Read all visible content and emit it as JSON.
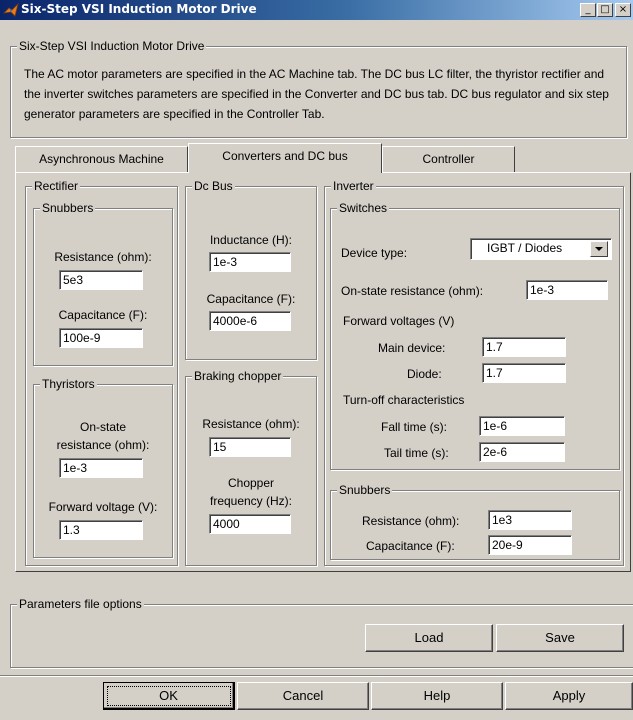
{
  "window": {
    "title": "Six-Step VSI Induction Motor Drive",
    "controls": [
      "_",
      "□",
      "×"
    ]
  },
  "header": {
    "group_title": "Six-Step VSI Induction Motor Drive",
    "description": "The AC motor parameters are specified in the AC Machine tab. The DC bus LC filter, the thyristor rectifier and the inverter switches parameters are specified in the Converter and DC bus tab. DC bus regulator and six step generator parameters are specified in the Controller Tab."
  },
  "tabs": [
    {
      "label": "Asynchronous Machine",
      "active": false
    },
    {
      "label": "Converters and DC bus",
      "active": true
    },
    {
      "label": "Controller",
      "active": false
    }
  ],
  "rectifier": {
    "title": "Rectifier",
    "snubbers": {
      "title": "Snubbers",
      "resistance_label": "Resistance (ohm):",
      "resistance_value": "5e3",
      "capacitance_label": "Capacitance (F):",
      "capacitance_value": "100e-9"
    },
    "thyristors": {
      "title": "Thyristors",
      "onstate_label_1": "On-state",
      "onstate_label_2": "resistance (ohm):",
      "onstate_value": "1e-3",
      "forward_voltage_label": "Forward voltage (V):",
      "forward_voltage_value": "1.3"
    }
  },
  "dc_bus": {
    "title": "Dc Bus",
    "inductance_label": "Inductance (H):",
    "inductance_value": "1e-3",
    "capacitance_label": "Capacitance (F):",
    "capacitance_value": "4000e-6"
  },
  "braking_chopper": {
    "title": "Braking chopper",
    "resistance_label": "Resistance (ohm):",
    "resistance_value": "15",
    "frequency_label_1": "Chopper",
    "frequency_label_2": "frequency (Hz):",
    "frequency_value": "4000"
  },
  "inverter": {
    "title": "Inverter",
    "switches": {
      "title": "Switches",
      "device_type_label": "Device type:",
      "device_type_value": "IGBT / Diodes",
      "onstate_label": "On-state resistance (ohm):",
      "onstate_value": "1e-3",
      "forward_voltages_label": "Forward voltages (V)",
      "main_device_label": "Main device:",
      "main_device_value": "1.7",
      "diode_label": "Diode:",
      "diode_value": "1.7",
      "turnoff_label": "Turn-off characteristics",
      "fall_time_label": "Fall time (s):",
      "fall_time_value": "1e-6",
      "tail_time_label": "Tail time (s):",
      "tail_time_value": "2e-6"
    },
    "snubbers": {
      "title": "Snubbers",
      "resistance_label": "Resistance (ohm):",
      "resistance_value": "1e3",
      "capacitance_label": "Capacitance (F):",
      "capacitance_value": "20e-9"
    }
  },
  "params_file": {
    "title": "Parameters file options",
    "load_label": "Load",
    "save_label": "Save"
  },
  "footer": {
    "ok_label": "OK",
    "cancel_label": "Cancel",
    "help_label": "Help",
    "apply_label": "Apply"
  }
}
